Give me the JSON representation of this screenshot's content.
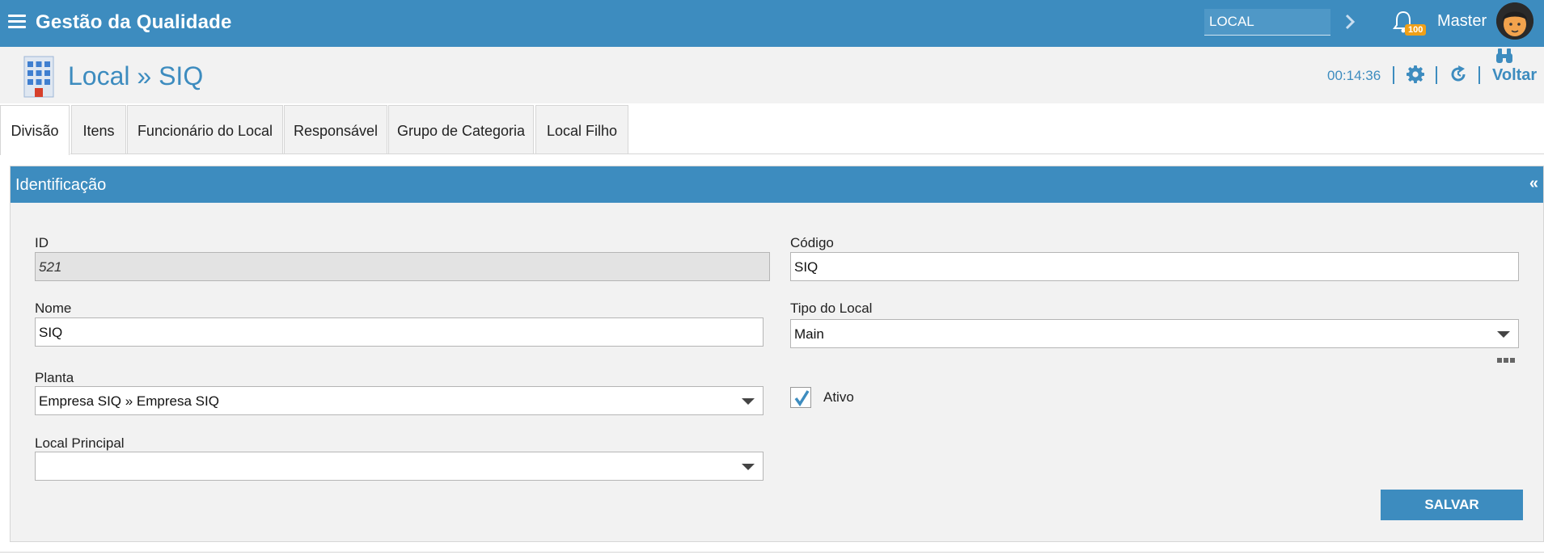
{
  "app": {
    "title": "Gestão da Qualidade",
    "search_value": "LOCAL",
    "notification_count": "100",
    "user_name": "Master"
  },
  "page": {
    "title": "Local » SIQ",
    "timer": "00:14:36",
    "back_label": "Voltar"
  },
  "tabs": [
    {
      "label": "Divisão",
      "active": true
    },
    {
      "label": "Itens",
      "active": false
    },
    {
      "label": "Funcionário do Local",
      "active": false
    },
    {
      "label": "Responsável",
      "active": false
    },
    {
      "label": "Grupo de Categoria",
      "active": false
    },
    {
      "label": "Local Filho",
      "active": false
    }
  ],
  "panel": {
    "title": "Identificação",
    "collapse_glyph": "«"
  },
  "form": {
    "id": {
      "label": "ID",
      "value": "521"
    },
    "codigo": {
      "label": "Código",
      "value": "SIQ"
    },
    "nome": {
      "label": "Nome",
      "value": "SIQ"
    },
    "tipo_local": {
      "label": "Tipo do Local",
      "value": "Main"
    },
    "planta": {
      "label": "Planta",
      "value": "Empresa SIQ » Empresa SIQ"
    },
    "ativo": {
      "label": "Ativo",
      "checked": true
    },
    "local_principal": {
      "label": "Local Principal",
      "value": ""
    },
    "save_label": "SALVAR"
  },
  "colors": {
    "primary": "#3d8cbf",
    "badge": "#f0a018",
    "panel_bg": "#f2f2f2"
  },
  "icons": {
    "menu": "menu-icon",
    "search_go": "chevron-right-icon",
    "notifications": "bell-icon",
    "page": "building-icon",
    "settings": "gear-icon",
    "refresh": "refresh-icon",
    "lookup": "binoculars-icon",
    "more": "more-dots-icon"
  }
}
